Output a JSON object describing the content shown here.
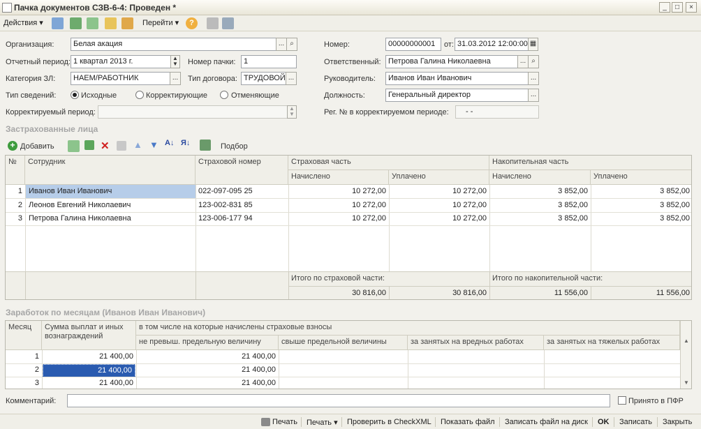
{
  "window": {
    "title": "Пачка документов СЗВ-6-4: Проведен *"
  },
  "toolbar": {
    "actions_label": "Действия",
    "goto_label": "Перейти"
  },
  "form": {
    "org_label": "Организация:",
    "org_value": "Белая акация",
    "period_label": "Отчетный период:",
    "period_value": "1 квартал 2013 г.",
    "pack_label": "Номер пачки:",
    "pack_value": "1",
    "category_label": "Категория ЗЛ:",
    "category_value": "НАЕМ/РАБОТНИК",
    "contract_label": "Тип договора:",
    "contract_value": "ТРУДОВОЙ",
    "info_type_label": "Тип сведений:",
    "radio_original": "Исходные",
    "radio_correcting": "Корректирующие",
    "radio_canceling": "Отменяющие",
    "corr_period_label": "Корректируемый период:",
    "corr_period_value": "",
    "number_label": "Номер:",
    "number_value": "00000000001",
    "date_label": "от:",
    "date_value": "31.03.2012 12:00:00",
    "responsible_label": "Ответственный:",
    "responsible_value": "Петрова Галина Николаевна",
    "head_label": "Руководитель:",
    "head_value": "Иванов Иван Иванович",
    "position_label": "Должность:",
    "position_value": "Генеральный директор",
    "reg_label": "Рег. № в корректируемом периоде:",
    "reg_value": "-   -"
  },
  "insured": {
    "section_title": "Застрахованные лица",
    "add_label": "Добавить",
    "pick_label": "Подбор",
    "headers": {
      "num": "№",
      "employee": "Сотрудник",
      "ins_number": "Страховой номер",
      "ins_part": "Страховая часть",
      "fund_part": "Накопительная часть",
      "accrued": "Начислено",
      "paid": "Уплачено"
    },
    "rows": [
      {
        "n": "1",
        "name": "Иванов Иван Иванович",
        "snils": "022-097-095 25",
        "ins_acc": "10 272,00",
        "ins_paid": "10 272,00",
        "fund_acc": "3 852,00",
        "fund_paid": "3 852,00"
      },
      {
        "n": "2",
        "name": "Леонов Евгений Николаевич",
        "snils": "123-002-831 85",
        "ins_acc": "10 272,00",
        "ins_paid": "10 272,00",
        "fund_acc": "3 852,00",
        "fund_paid": "3 852,00"
      },
      {
        "n": "3",
        "name": "Петрова Галина Николаевна",
        "snils": "123-006-177 94",
        "ins_acc": "10 272,00",
        "ins_paid": "10 272,00",
        "fund_acc": "3 852,00",
        "fund_paid": "3 852,00"
      }
    ],
    "total_ins_label": "Итого по страховой части:",
    "total_fund_label": "Итого по накопительной части:",
    "total_ins_acc": "30 816,00",
    "total_ins_paid": "30 816,00",
    "total_fund_acc": "11 556,00",
    "total_fund_paid": "11 556,00"
  },
  "earnings": {
    "section_title": "Заработок по месяцам (Иванов Иван Иванович)",
    "headers": {
      "month": "Месяц",
      "sum_l1": "Сумма выплат и иных",
      "sum_l2": "вознаграждений",
      "incl": "в том числе на которые начислены страховые взносы",
      "within": "не превыш. предельную величину",
      "above": "свыше предельной величины",
      "harmful": "за занятых на вредных работах",
      "heavy": "за занятых на тяжелых работах"
    },
    "rows": [
      {
        "m": "1",
        "sum": "21 400,00",
        "within": "21 400,00"
      },
      {
        "m": "2",
        "sum": "21 400,00",
        "within": "21 400,00"
      },
      {
        "m": "3",
        "sum": "21 400,00",
        "within": "21 400,00"
      }
    ]
  },
  "comment": {
    "label": "Комментарий:",
    "value": "",
    "accepted_label": "Принято в ПФР"
  },
  "bottom": {
    "print": "Печать",
    "print_menu": "Печать",
    "check": "Проверить в CheckXML",
    "show_file": "Показать файл",
    "save_file": "Записать файл на диск",
    "ok": "OK",
    "save": "Записать",
    "close": "Закрыть"
  }
}
